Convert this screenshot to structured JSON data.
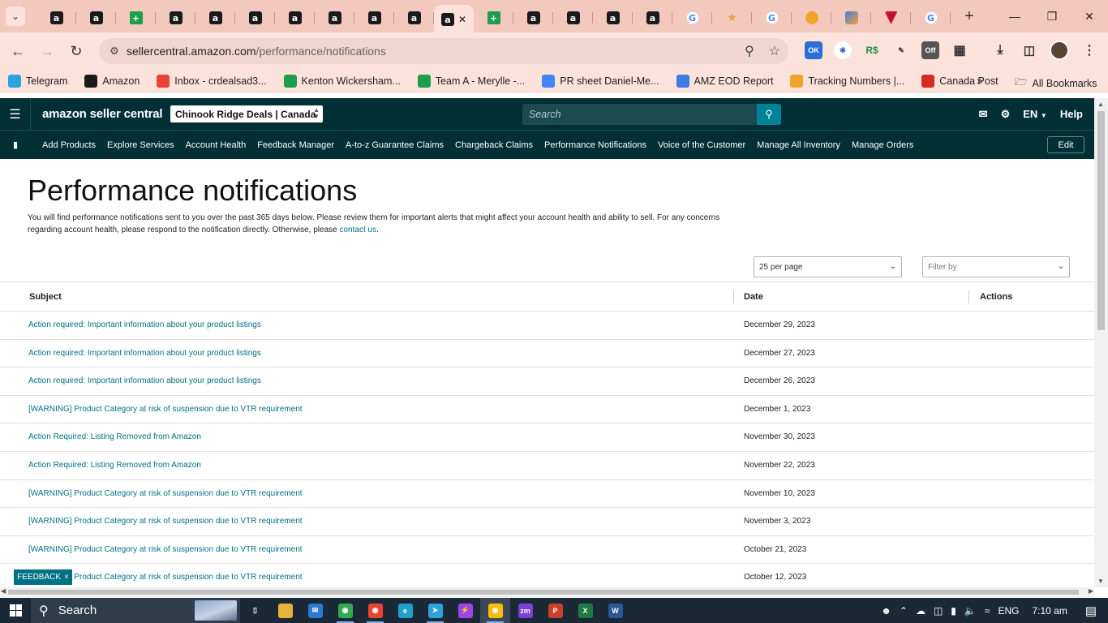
{
  "browser": {
    "tabs": [
      {
        "icon": "amazon-icon",
        "kind": "amz",
        "glyph": "a",
        "active": false
      },
      {
        "icon": "amazon-icon",
        "kind": "amz",
        "glyph": "a",
        "active": false
      },
      {
        "icon": "sheets-icon",
        "kind": "sheet",
        "glyph": "+",
        "active": false
      },
      {
        "icon": "amazon-icon",
        "kind": "amz",
        "glyph": "a",
        "active": false
      },
      {
        "icon": "amazon-icon",
        "kind": "amz",
        "glyph": "a",
        "active": false
      },
      {
        "icon": "amazon-icon",
        "kind": "amz",
        "glyph": "a",
        "active": false
      },
      {
        "icon": "amazon-icon",
        "kind": "amz",
        "glyph": "a",
        "active": false
      },
      {
        "icon": "amazon-icon",
        "kind": "amz",
        "glyph": "a",
        "active": false
      },
      {
        "icon": "amazon-icon",
        "kind": "amz",
        "glyph": "a",
        "active": false
      },
      {
        "icon": "amazon-icon",
        "kind": "amz",
        "glyph": "a",
        "active": false
      },
      {
        "icon": "amazon-icon",
        "kind": "amz",
        "glyph": "a",
        "active": true
      },
      {
        "icon": "sheets-icon",
        "kind": "sheet",
        "glyph": "+",
        "active": false
      },
      {
        "icon": "amazon-icon",
        "kind": "amz",
        "glyph": "a",
        "active": false
      },
      {
        "icon": "amazon-icon",
        "kind": "amz",
        "glyph": "a",
        "active": false
      },
      {
        "icon": "amazon-icon",
        "kind": "amz",
        "glyph": "a",
        "active": false
      },
      {
        "icon": "amazon-icon",
        "kind": "amz",
        "glyph": "a",
        "active": false
      },
      {
        "icon": "google-icon",
        "kind": "goog",
        "glyph": "G",
        "active": false
      },
      {
        "icon": "star-icon",
        "kind": "star",
        "glyph": "★",
        "active": false
      },
      {
        "icon": "google-icon",
        "kind": "goog",
        "glyph": "G",
        "active": false
      },
      {
        "icon": "taco-icon",
        "kind": "taco",
        "glyph": "",
        "active": false
      },
      {
        "icon": "pen-icon",
        "kind": "pen",
        "glyph": "",
        "active": false
      },
      {
        "icon": "gyf-icon",
        "kind": "gyf",
        "glyph": "",
        "active": false
      },
      {
        "icon": "google-icon",
        "kind": "goog",
        "glyph": "G",
        "active": false
      }
    ],
    "url_host": "sellercentral.amazon.com",
    "url_path": "/performance/notifications",
    "bookmarks": [
      {
        "label": "Telegram",
        "icon": "telegram-icon",
        "color": "#2aa3df"
      },
      {
        "label": "Amazon",
        "icon": "amazon-icon",
        "color": "#1a1a1a"
      },
      {
        "label": "Inbox - crdealsad3...",
        "icon": "gmail-icon",
        "color": "#ea4335"
      },
      {
        "label": "Kenton Wickersham...",
        "icon": "sheets-icon",
        "color": "#1e9e4a"
      },
      {
        "label": "Team A - Merylle -...",
        "icon": "sheets-icon",
        "color": "#1e9e4a"
      },
      {
        "label": "PR sheet Daniel-Me...",
        "icon": "google-icon",
        "color": "#4285f4"
      },
      {
        "label": "AMZ EOD Report",
        "icon": "pen-icon",
        "color": "#3e7be5"
      },
      {
        "label": "Tracking Numbers |...",
        "icon": "taco-icon",
        "color": "#f1a42c"
      },
      {
        "label": "Canada Post",
        "icon": "canada-post-icon",
        "color": "#d52b1e"
      }
    ],
    "all_bookmarks": "All Bookmarks"
  },
  "seller_central": {
    "logo_text": "amazon seller central",
    "store": "Chinook Ridge Deals | Canada",
    "search_placeholder": "Search",
    "lang": "EN",
    "help": "Help",
    "nav": [
      "Add Products",
      "Explore Services",
      "Account Health",
      "Feedback Manager",
      "A-to-z Guarantee Claims",
      "Chargeback Claims",
      "Performance Notifications",
      "Voice of the Customer",
      "Manage All Inventory",
      "Manage Orders"
    ],
    "edit": "Edit"
  },
  "page": {
    "title": "Performance notifications",
    "intro": "You will find performance notifications sent to you over the past 365 days below. Please review them for important alerts that might affect your account health and ability to sell. For any concerns regarding account health, please respond to the notification directly. Otherwise, please ",
    "contact_link": "contact us",
    "intro_end": ".",
    "per_page": "25 per page",
    "filter_placeholder": "Filter by",
    "columns": {
      "subject": "Subject",
      "date": "Date",
      "actions": "Actions"
    },
    "rows": [
      {
        "subject": "Action required: Important information about your product listings",
        "date": "December 29, 2023"
      },
      {
        "subject": "Action required: Important information about your product listings",
        "date": "December 27, 2023"
      },
      {
        "subject": "Action required: Important information about your product listings",
        "date": "December 26, 2023"
      },
      {
        "subject": "[WARNING] Product Category at risk of suspension due to VTR requirement",
        "date": "December 1, 2023"
      },
      {
        "subject": "Action Required: Listing Removed from Amazon",
        "date": "November 30, 2023"
      },
      {
        "subject": "Action Required: Listing Removed from Amazon",
        "date": "November 22, 2023"
      },
      {
        "subject": "[WARNING] Product Category at risk of suspension due to VTR requirement",
        "date": "November 10, 2023"
      },
      {
        "subject": "[WARNING] Product Category at risk of suspension due to VTR requirement",
        "date": "November 3, 2023"
      },
      {
        "subject": "[WARNING] Product Category at risk of suspension due to VTR requirement",
        "date": "October 21, 2023"
      },
      {
        "subject": "[WARNING] Product Category at risk of suspension due to VTR requirement",
        "date": "October 12, 2023"
      }
    ],
    "feedback": "FEEDBACK"
  },
  "taskbar": {
    "search": "Search",
    "lang": "ENG",
    "time": "7:10 am",
    "apps": [
      {
        "icon": "task-view-icon",
        "color": "#1b2836",
        "glyph": "▯",
        "active": false,
        "open": false
      },
      {
        "icon": "file-explorer-icon",
        "color": "#e8b33a",
        "glyph": "",
        "active": false,
        "open": false
      },
      {
        "icon": "mail-icon",
        "color": "#2a7ad5",
        "glyph": "✉",
        "active": false,
        "open": false
      },
      {
        "icon": "chrome-icon",
        "color": "#34a853",
        "glyph": "◉",
        "active": false,
        "open": true
      },
      {
        "icon": "chrome-icon",
        "color": "#ea4335",
        "glyph": "◉",
        "active": false,
        "open": true
      },
      {
        "icon": "edge-icon",
        "color": "#1fa0c8",
        "glyph": "e",
        "active": false,
        "open": false
      },
      {
        "icon": "telegram-icon",
        "color": "#2aa3df",
        "glyph": "➤",
        "active": false,
        "open": true
      },
      {
        "icon": "messenger-icon",
        "color": "#a045e6",
        "glyph": "⚡",
        "active": false,
        "open": false
      },
      {
        "icon": "chrome-icon",
        "color": "#fbbc05",
        "glyph": "◉",
        "active": true,
        "open": true
      },
      {
        "icon": "zoom-icon",
        "color": "#7b3fd4",
        "glyph": "zm",
        "active": false,
        "open": false
      },
      {
        "icon": "app-icon",
        "color": "#c8402a",
        "glyph": "P",
        "active": false,
        "open": false
      },
      {
        "icon": "excel-icon",
        "color": "#1d7a45",
        "glyph": "X",
        "active": false,
        "open": false
      },
      {
        "icon": "word-icon",
        "color": "#2b5797",
        "glyph": "W",
        "active": false,
        "open": false
      }
    ]
  }
}
